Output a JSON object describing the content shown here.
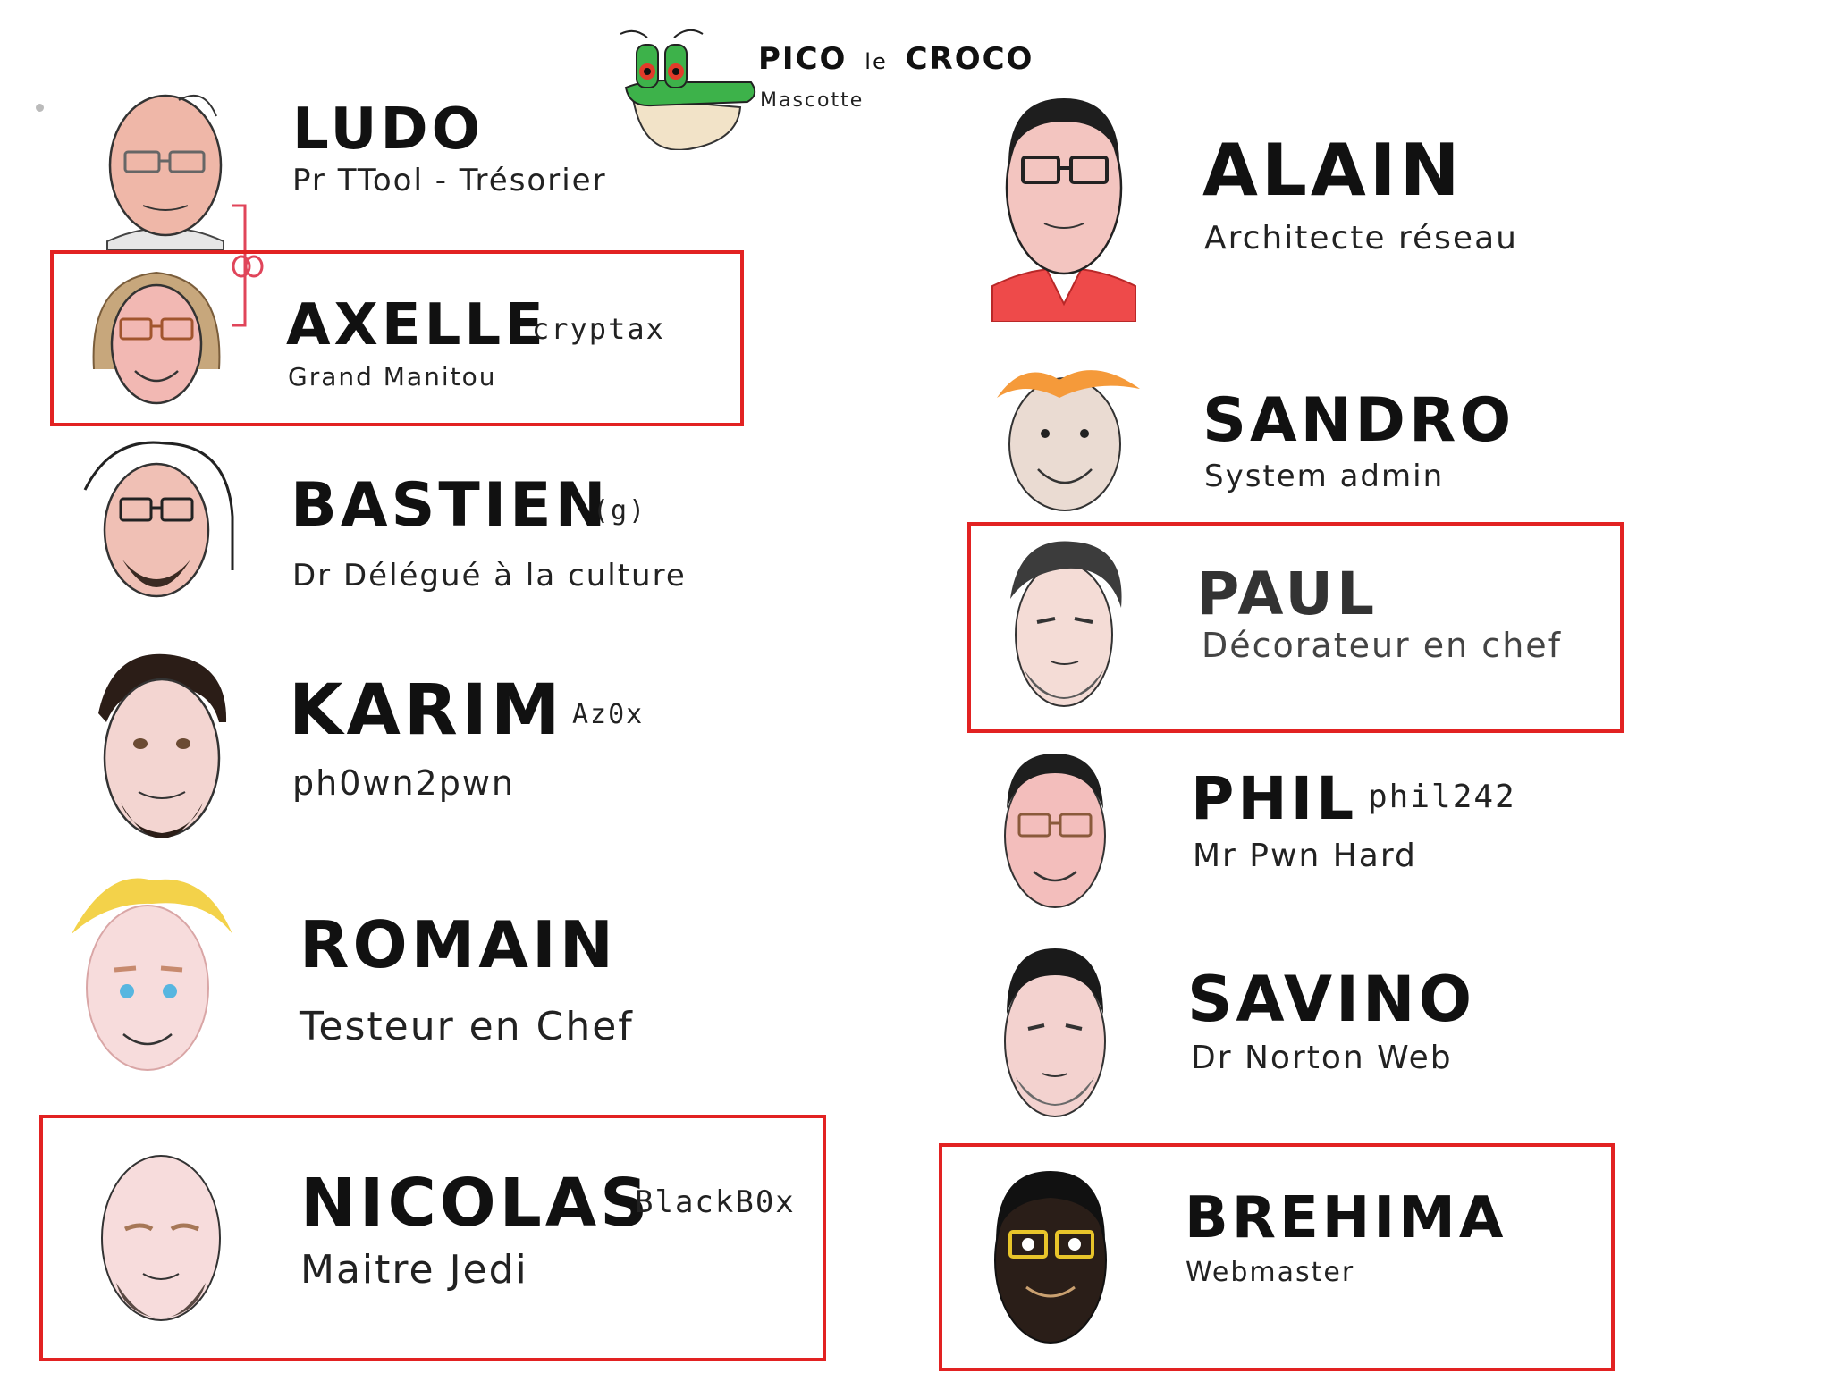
{
  "mascot": {
    "first": "PICO",
    "middle": "le",
    "last": "CROCO",
    "role": "Mascotte"
  },
  "members": {
    "ludo": {
      "name": "LUDO",
      "nick": "",
      "role": "Pr TTool - Trésorier"
    },
    "axelle": {
      "name": "AXELLE",
      "nick": "cryptax",
      "role": "Grand Manitou"
    },
    "bastien": {
      "name": "BASTIEN",
      "nick": "(g)",
      "role": "Dr Délégué à la culture"
    },
    "karim": {
      "name": "KARIM",
      "nick": "Az0x",
      "role": "ph0wn2pwn"
    },
    "romain": {
      "name": "ROMAIN",
      "nick": "",
      "role": "Testeur en Chef"
    },
    "nicolas": {
      "name": "NICOLAS",
      "nick": "BlackB0x",
      "role": "Maitre Jedi"
    },
    "alain": {
      "name": "ALAIN",
      "nick": "",
      "role": "Architecte réseau"
    },
    "sandro": {
      "name": "SANDRO",
      "nick": "",
      "role": "System admin"
    },
    "paul": {
      "name": "PAUL",
      "nick": "",
      "role": "Décorateur en chef"
    },
    "phil": {
      "name": "PHIL",
      "nick": "phil242",
      "role": "Mr Pwn Hard"
    },
    "savino": {
      "name": "SAVINO",
      "nick": "",
      "role": "Dr Norton Web"
    },
    "brehima": {
      "name": "BREHIMA",
      "nick": "",
      "role": "Webmaster"
    }
  },
  "colors": {
    "highlight_frame": "#e22222",
    "link": "#e0455a",
    "text": "#111111"
  },
  "icons": {
    "mascot": "crocodile-mascot-icon",
    "avatar": "cartoon-face-icon",
    "link": "chain-link-icon"
  }
}
